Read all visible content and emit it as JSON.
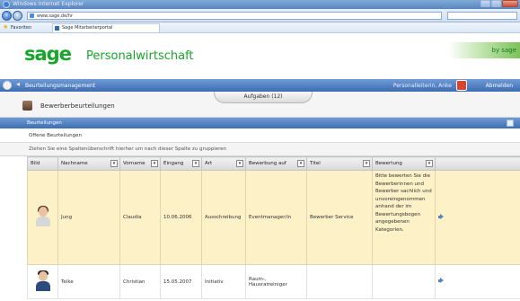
{
  "browser": {
    "title": "Windows Internet Explorer",
    "url": "www.sage.de/hr",
    "favorites_label": "Favoriten",
    "tab_label": "Sage Mitarbeiterportal"
  },
  "brand": {
    "logo": "sage",
    "product": "Personalwirtschaft",
    "tagline": "by sage",
    "accent_green": "#17a62b",
    "nav_blue": "#3d6db2",
    "row_highlight": "#fdf1c8"
  },
  "nav": {
    "breadcrumb": "Beurteilungsmanagement",
    "user": "Personalleiterin, Anke",
    "logout_label": "Abmelden"
  },
  "page": {
    "title": "Bewerberbeurteilungen",
    "tasks_tab": "Aufgaben (12)"
  },
  "panel": {
    "header": "Beurteilungen",
    "subtitle": "Offene Beurteilungen",
    "group_hint": "Ziehen Sie eine Spaltenüberschrift hierher um nach dieser Spalte zu gruppieren"
  },
  "grid": {
    "columns": [
      "Bild",
      "Nachname",
      "Vorname",
      "Eingang",
      "Art",
      "Bewerbung auf",
      "Titel",
      "Bewertung"
    ],
    "filter_glyph": "▾",
    "rows": [
      {
        "nachname": "Jung",
        "vorname": "Claudia",
        "eingang": "10.06.2006",
        "art": "Ausschreibung",
        "bewerbung_auf": "Eventmanager/in",
        "titel": "Bewerber Service",
        "bewertung": "Bitte bewerten Sie die Bewerberinnen und Bewerber sachlich und unvoreingenommen anhand der im Bewertungsbogen angegebenen Kategorien."
      },
      {
        "nachname": "Telke",
        "vorname": "Christian",
        "eingang": "15.05.2007",
        "art": "Initiativ",
        "bewerbung_auf": "Raum-, Hausratreiniger",
        "titel": "",
        "bewertung": ""
      }
    ]
  }
}
